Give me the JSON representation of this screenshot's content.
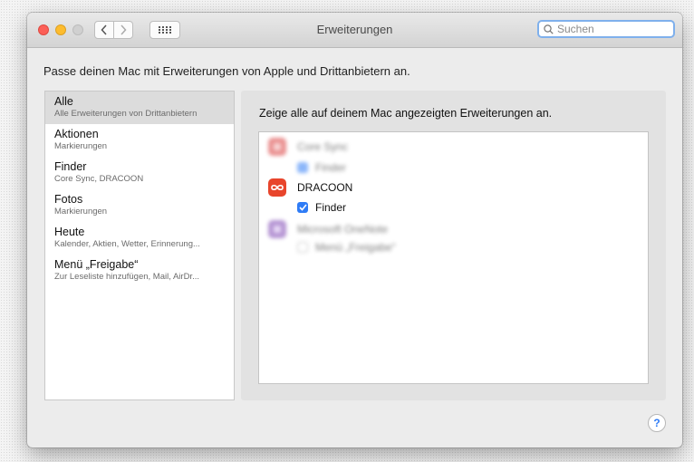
{
  "window": {
    "title": "Erweiterungen",
    "search_placeholder": "Suchen"
  },
  "subtitle": "Passe deinen Mac mit Erweiterungen von Apple und Drittanbietern an.",
  "sidebar": {
    "items": [
      {
        "title": "Alle",
        "desc": "Alle Erweiterungen von Drittanbietern",
        "selected": true
      },
      {
        "title": "Aktionen",
        "desc": "Markierungen",
        "selected": false
      },
      {
        "title": "Finder",
        "desc": "Core Sync, DRACOON",
        "selected": false
      },
      {
        "title": "Fotos",
        "desc": "Markierungen",
        "selected": false
      },
      {
        "title": "Heute",
        "desc": "Kalender, Aktien, Wetter, Erinnerung...",
        "selected": false
      },
      {
        "title": "Menü „Freigabe“",
        "desc": "Zur Leseliste hinzufügen, Mail, AirDr...",
        "selected": false
      }
    ]
  },
  "main": {
    "header": "Zeige alle auf deinem Mac angezeigten Erweiterungen an.",
    "extensions": [
      {
        "app": "Core Sync",
        "icon": "core-sync-icon",
        "color": "#d93a3a",
        "option": "Finder",
        "checked": true,
        "blurred": true
      },
      {
        "app": "DRACOON",
        "icon": "dracoon-icon",
        "color": "#e8452c",
        "option": "Finder",
        "checked": true,
        "blurred": false
      },
      {
        "app": "Microsoft OneNote",
        "icon": "onenote-icon",
        "color": "#7a3fb0",
        "option": "Menü „Freigabe“",
        "checked": false,
        "blurred": true
      }
    ]
  },
  "colors": {
    "accent": "#2f7cf6",
    "search_focus": "#7fb0ec"
  },
  "help": {
    "label": "?"
  }
}
